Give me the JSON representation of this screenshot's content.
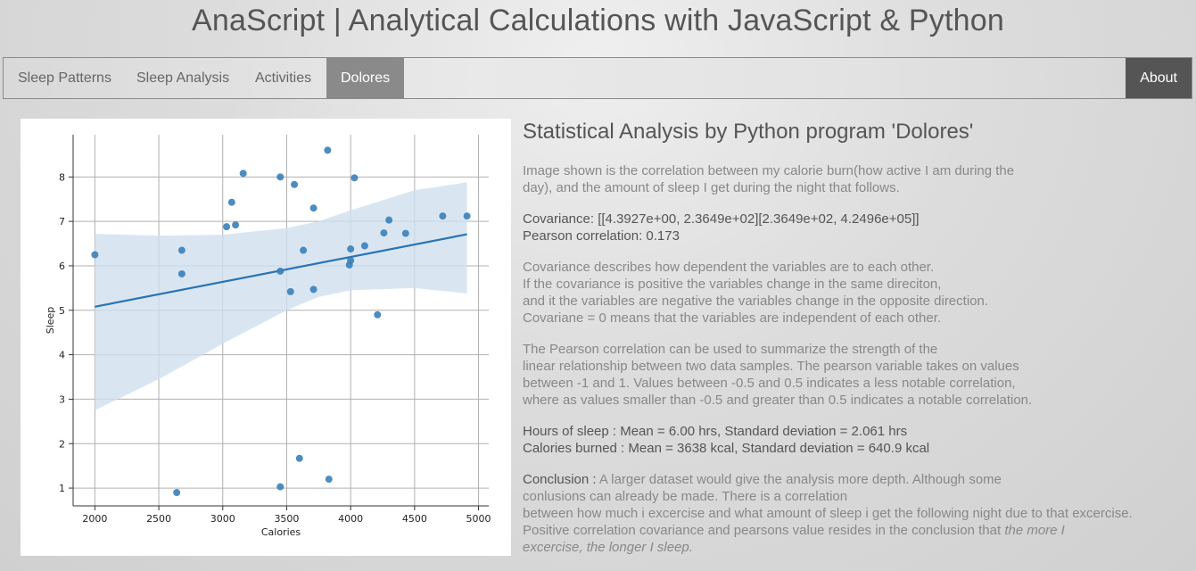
{
  "header": {
    "title": "AnaScript | Analytical Calculations with JavaScript & Python"
  },
  "nav": {
    "items": [
      {
        "label": "Sleep Patterns"
      },
      {
        "label": "Sleep Analysis"
      },
      {
        "label": "Activities"
      },
      {
        "label": "Dolores"
      }
    ],
    "about": "About",
    "active": "Dolores"
  },
  "colors": {
    "point": "#3a7fb8",
    "line": "#2a73b3",
    "band": "#cfe0ef",
    "active_tab": "#8a8a8a",
    "about_tab": "#555555"
  },
  "main": {
    "heading": "Statistical Analysis by Python program 'Dolores'",
    "intro": [
      "Image shown is the correlation between my calorie burn(how active I am during the",
      "day), and the amount of sleep I get during the night that follows."
    ],
    "stats": [
      "Covariance: [[4.3927e+00, 2.3649e+02][2.3649e+02, 4.2496e+05]]",
      "Pearson correlation: 0.173"
    ],
    "covariance_text": [
      "Covariance describes how dependent the variables are to each other.",
      "If the covariance is positive the variables change in the same direciton,",
      "and it the variables are negative the variables change in the opposite direction.",
      "Covariane = 0 means that the variables are independent of each other."
    ],
    "pearson_text": [
      "The Pearson correlation can be used to summarize the strength of the",
      "linear relationship between two data samples. The pearson variable takes on values",
      "between -1 and 1. Values between -0.5 and 0.5 indicates a less notable correlation,",
      "where as values smaller than -0.5 and greater than 0.5 indicates a notable correlation."
    ],
    "means": [
      "Hours of sleep : Mean = 6.00 hrs, Standard deviation = 2.061 hrs",
      "Calories burned : Mean = 3638 kcal, Standard deviation = 640.9 kcal"
    ],
    "conclusion": {
      "label": "Conclusion :",
      "line1": " A larger dataset would give the analysis more depth. Although some",
      "line2": "conlusions can already be made. There is a correlation",
      "line3": "between how much i excercise and what amount of sleep i get the following night due to that excercise.",
      "line4": "Positive correlation covariance and pearsons value resides in the conclusion that ",
      "emphasis1": "the more I",
      "emphasis2": "excercise, the longer I sleep."
    }
  },
  "chart_data": {
    "type": "scatter",
    "xlabel": "Calories",
    "ylabel": "Sleep",
    "xlim": [
      1830,
      5080
    ],
    "ylim": [
      0.6,
      8.95
    ],
    "xticks": [
      2000,
      2500,
      3000,
      3500,
      4000,
      4500,
      5000
    ],
    "yticks": [
      1,
      2,
      3,
      4,
      5,
      6,
      7,
      8
    ],
    "grid": true,
    "points": [
      [
        2000,
        6.25
      ],
      [
        2640,
        0.9
      ],
      [
        2680,
        6.35
      ],
      [
        2680,
        5.82
      ],
      [
        3030,
        6.88
      ],
      [
        3070,
        7.43
      ],
      [
        3100,
        6.92
      ],
      [
        3160,
        8.08
      ],
      [
        3450,
        8.0
      ],
      [
        3450,
        5.88
      ],
      [
        3450,
        1.03
      ],
      [
        3530,
        5.42
      ],
      [
        3560,
        7.83
      ],
      [
        3600,
        1.67
      ],
      [
        3630,
        6.35
      ],
      [
        3710,
        5.47
      ],
      [
        3710,
        7.3
      ],
      [
        3820,
        8.6
      ],
      [
        3830,
        1.2
      ],
      [
        3990,
        6.02
      ],
      [
        4000,
        6.12
      ],
      [
        4000,
        6.38
      ],
      [
        4030,
        7.98
      ],
      [
        4110,
        6.45
      ],
      [
        4210,
        4.9
      ],
      [
        4260,
        6.74
      ],
      [
        4300,
        7.03
      ],
      [
        4430,
        6.73
      ],
      [
        4720,
        7.12
      ],
      [
        4910,
        7.12
      ]
    ],
    "regression": {
      "x": [
        2000,
        4910
      ],
      "y": [
        5.08,
        6.71
      ]
    },
    "confidence_band": {
      "x": [
        2000,
        2500,
        3000,
        3500,
        3750,
        4000,
        4500,
        4910
      ],
      "upper": [
        6.72,
        6.68,
        6.7,
        6.85,
        7.0,
        7.25,
        7.7,
        7.88
      ],
      "lower": [
        2.75,
        3.45,
        4.25,
        5.0,
        5.3,
        5.45,
        5.5,
        5.38
      ]
    }
  }
}
